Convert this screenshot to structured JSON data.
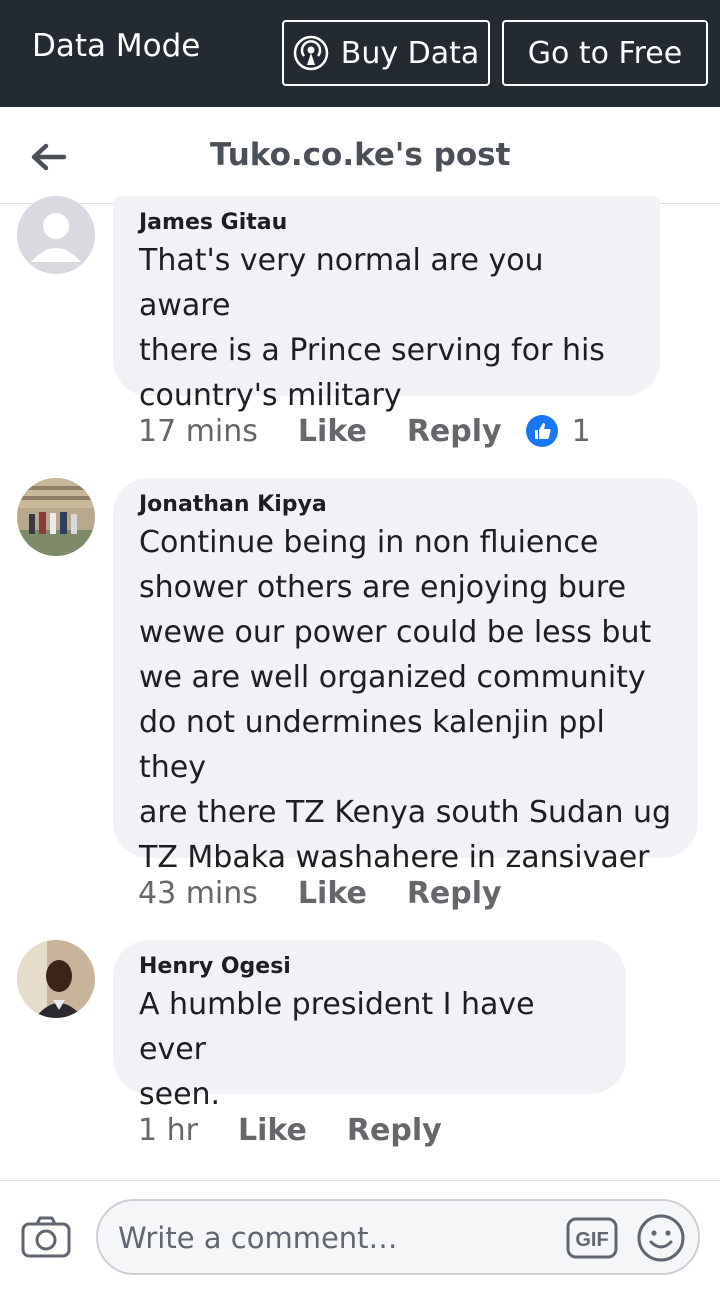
{
  "databar": {
    "mode_label": "Data Mode",
    "buy_label": "Buy Data",
    "free_label": "Go to Free"
  },
  "header": {
    "title": "Tuko.co.ke's post"
  },
  "comments": [
    {
      "author": "James Gitau",
      "lines": [
        "That's very normal are you aware",
        "there is a Prince serving for his",
        "country's military"
      ],
      "time": "17 mins",
      "like_label": "Like",
      "reply_label": "Reply",
      "reaction_count": "1"
    },
    {
      "author": "Jonathan Kipya",
      "lines": [
        "Continue being in non fluience",
        "shower others are enjoying bure",
        "wewe our power could be less but",
        "we are well organized community",
        "do not undermines kalenjin ppl they",
        "are there TZ Kenya south Sudan ug",
        "TZ Mbaka washahere in zansivaer"
      ],
      "time": "43 mins",
      "like_label": "Like",
      "reply_label": "Reply"
    },
    {
      "author": "Henry Ogesi",
      "lines": [
        "A humble president I have ever",
        "seen."
      ],
      "time": "1 hr",
      "like_label": "Like",
      "reply_label": "Reply"
    }
  ],
  "composer": {
    "placeholder": "Write a comment…",
    "gif_label": "GIF"
  },
  "icons": {
    "back": "arrow-left-icon",
    "buy": "broadcast-icon",
    "like": "thumbs-up-icon",
    "camera": "camera-icon",
    "gif": "gif-icon",
    "emoji": "smiley-icon"
  },
  "colors": {
    "databar_bg": "#242a32",
    "bubble_bg": "#f0f2f5",
    "like_blue": "#1877f2",
    "meta_gray": "#65676b"
  }
}
